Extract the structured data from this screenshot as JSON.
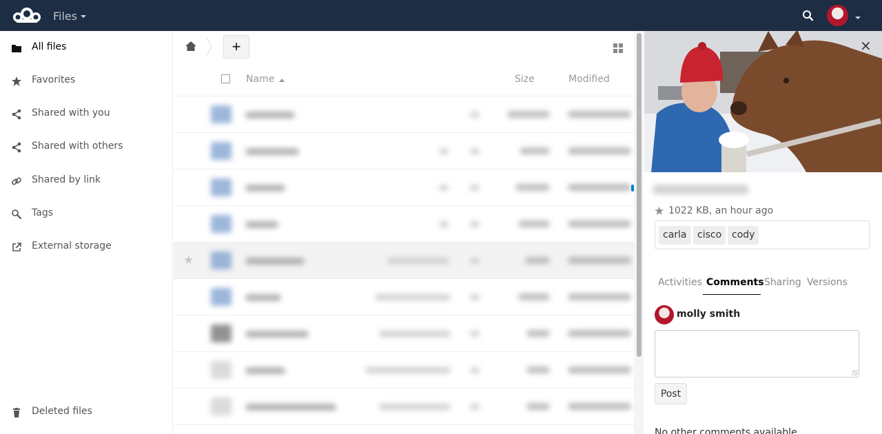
{
  "header": {
    "app_title": "Files",
    "icons": [
      "logo-icon",
      "search-icon",
      "avatar",
      "chevron-down-icon"
    ]
  },
  "sidebar": {
    "items": [
      {
        "label": "All files",
        "icon": "folder-icon",
        "active": true
      },
      {
        "label": "Favorites",
        "icon": "star-icon"
      },
      {
        "label": "Shared with you",
        "icon": "share-icon"
      },
      {
        "label": "Shared with others",
        "icon": "share-icon"
      },
      {
        "label": "Shared by link",
        "icon": "link-icon"
      },
      {
        "label": "Tags",
        "icon": "tag-icon"
      },
      {
        "label": "External storage",
        "icon": "external-link-icon"
      }
    ],
    "deleted": {
      "label": "Deleted files",
      "icon": "trash-icon"
    }
  },
  "file_list": {
    "new_button": "+",
    "columns": {
      "name": "Name",
      "size": "Size",
      "modified": "Modified"
    }
  },
  "details": {
    "meta": "1022 KB, an hour ago",
    "tags": [
      "carla",
      "cisco",
      "cody"
    ],
    "tabs": [
      "Activities",
      "Comments",
      "Sharing",
      "Versions"
    ],
    "active_tab": "Comments",
    "commenter": "molly smith",
    "post_label": "Post",
    "no_comments": "No other comments available"
  },
  "colors": {
    "header_bg": "#1d2d44",
    "accent": "#0082c9"
  }
}
